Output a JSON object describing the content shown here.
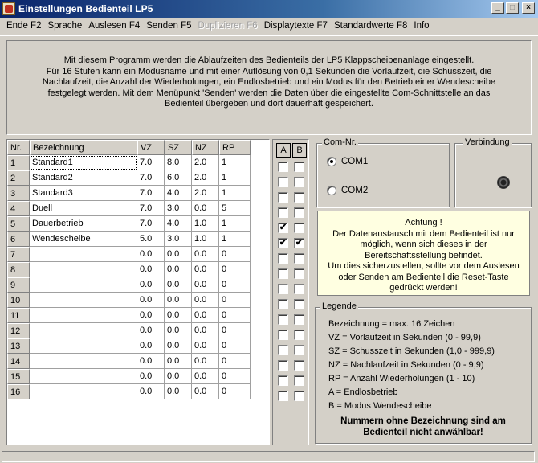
{
  "window": {
    "title": "Einstellungen Bedienteil LP5",
    "minimize": "_",
    "maximize": "□",
    "close": "×"
  },
  "menu": [
    {
      "label": "Ende F2",
      "enabled": true
    },
    {
      "label": "Sprache",
      "enabled": true
    },
    {
      "label": "Auslesen F4",
      "enabled": true
    },
    {
      "label": "Senden F5",
      "enabled": true
    },
    {
      "label": "Duplizieren F6",
      "enabled": false
    },
    {
      "label": "Displaytexte F7",
      "enabled": true
    },
    {
      "label": "Standardwerte F8",
      "enabled": true
    },
    {
      "label": "Info",
      "enabled": true
    }
  ],
  "description": {
    "lines": [
      "Mit diesem Programm werden die Ablaufzeiten des Bedienteils der LP5 Klappscheibenanlage eingestellt.",
      "Für 16 Stufen kann ein Modusname und mit einer Auflösung von 0,1 Sekunden die Vorlaufzeit, die Schusszeit, die",
      "Nachlaufzeit, die Anzahl der Wiederholungen, ein Endlosbetrieb und ein Modus für den Betrieb einer Wendescheibe",
      "festgelegt werden. Mit dem Menüpunkt 'Senden' werden die Daten über die eingestellte Com-Schnittstelle an das",
      "Bedienteil übergeben und dort dauerhaft gespeichert."
    ]
  },
  "grid": {
    "headers": {
      "nr": "Nr.",
      "name": "Bezeichnung",
      "vz": "VZ",
      "sz": "SZ",
      "nz": "NZ",
      "rp": "RP"
    },
    "checkbox_headers": {
      "a": "A",
      "b": "B"
    },
    "rows": [
      {
        "nr": "1",
        "name": "Standard1",
        "vz": "7.0",
        "sz": "8.0",
        "nz": "2.0",
        "rp": "1",
        "a": false,
        "b": false
      },
      {
        "nr": "2",
        "name": "Standard2",
        "vz": "7.0",
        "sz": "6.0",
        "nz": "2.0",
        "rp": "1",
        "a": false,
        "b": false
      },
      {
        "nr": "3",
        "name": "Standard3",
        "vz": "7.0",
        "sz": "4.0",
        "nz": "2.0",
        "rp": "1",
        "a": false,
        "b": false
      },
      {
        "nr": "4",
        "name": "Duell",
        "vz": "7.0",
        "sz": "3.0",
        "nz": "0.0",
        "rp": "5",
        "a": false,
        "b": false
      },
      {
        "nr": "5",
        "name": "Dauerbetrieb",
        "vz": "7.0",
        "sz": "4.0",
        "nz": "1.0",
        "rp": "1",
        "a": true,
        "b": false
      },
      {
        "nr": "6",
        "name": "Wendescheibe",
        "vz": "5.0",
        "sz": "3.0",
        "nz": "1.0",
        "rp": "1",
        "a": true,
        "b": true
      },
      {
        "nr": "7",
        "name": "",
        "vz": "0.0",
        "sz": "0.0",
        "nz": "0.0",
        "rp": "0",
        "a": false,
        "b": false
      },
      {
        "nr": "8",
        "name": "",
        "vz": "0.0",
        "sz": "0.0",
        "nz": "0.0",
        "rp": "0",
        "a": false,
        "b": false
      },
      {
        "nr": "9",
        "name": "",
        "vz": "0.0",
        "sz": "0.0",
        "nz": "0.0",
        "rp": "0",
        "a": false,
        "b": false
      },
      {
        "nr": "10",
        "name": "",
        "vz": "0.0",
        "sz": "0.0",
        "nz": "0.0",
        "rp": "0",
        "a": false,
        "b": false
      },
      {
        "nr": "11",
        "name": "",
        "vz": "0.0",
        "sz": "0.0",
        "nz": "0.0",
        "rp": "0",
        "a": false,
        "b": false
      },
      {
        "nr": "12",
        "name": "",
        "vz": "0.0",
        "sz": "0.0",
        "nz": "0.0",
        "rp": "0",
        "a": false,
        "b": false
      },
      {
        "nr": "13",
        "name": "",
        "vz": "0.0",
        "sz": "0.0",
        "nz": "0.0",
        "rp": "0",
        "a": false,
        "b": false
      },
      {
        "nr": "14",
        "name": "",
        "vz": "0.0",
        "sz": "0.0",
        "nz": "0.0",
        "rp": "0",
        "a": false,
        "b": false
      },
      {
        "nr": "15",
        "name": "",
        "vz": "0.0",
        "sz": "0.0",
        "nz": "0.0",
        "rp": "0",
        "a": false,
        "b": false
      },
      {
        "nr": "16",
        "name": "",
        "vz": "0.0",
        "sz": "0.0",
        "nz": "0.0",
        "rp": "0",
        "a": false,
        "b": false
      }
    ]
  },
  "com": {
    "label": "Com-Nr.",
    "options": [
      {
        "label": "COM1",
        "selected": true
      },
      {
        "label": "COM2",
        "selected": false
      }
    ]
  },
  "connection": {
    "label": "Verbindung",
    "status_icon": "led-indicator-icon"
  },
  "warning": {
    "lines": [
      "Achtung !",
      "Der Datenaustausch mit dem Bedienteil ist nur",
      "möglich, wenn sich dieses in der",
      "Bereitschaftsstellung befindet.",
      "Um dies sicherzustellen, sollte vor dem Auslesen",
      "oder Senden am Bedienteil die Reset-Taste",
      "gedrückt werden!"
    ]
  },
  "legend": {
    "label": "Legende",
    "lines": [
      "Bezeichnung = max. 16 Zeichen",
      "VZ = Vorlaufzeit in Sekunden (0 - 99,9)",
      "SZ = Schusszeit in Sekunden (1,0 - 999,9)",
      "NZ = Nachlaufzeit in Sekunden (0 - 9,9)",
      "RP = Anzahl Wiederholungen (1 - 10)",
      "A = Endlosbetrieb",
      "B = Modus Wendescheibe"
    ],
    "note": [
      "Nummern ohne Bezeichnung sind am",
      "Bedienteil nicht anwählbar!"
    ]
  },
  "colors": {
    "face": "#d4d0c8",
    "title_start": "#0a246a",
    "title_end": "#a6caf0",
    "warning_bg": "#ffffe1"
  }
}
